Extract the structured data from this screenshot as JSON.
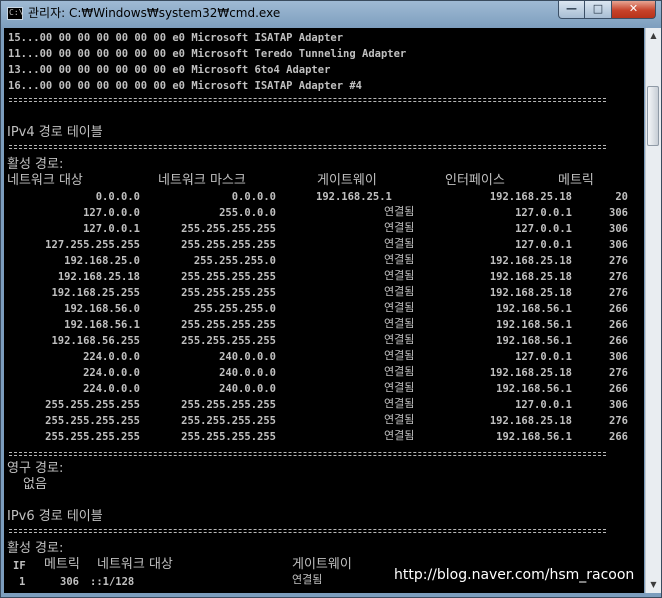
{
  "window": {
    "title": "관리자: C:₩Windows₩system32₩cmd.exe",
    "icon_glyph": "C:\\"
  },
  "buttons": {
    "minimize": "—",
    "maximize": "□",
    "close": "✕"
  },
  "interfaces": [
    "15...00 00 00 00 00 00 00 e0 Microsoft ISATAP Adapter",
    "11...00 00 00 00 00 00 00 e0 Microsoft Teredo Tunneling Adapter",
    "13...00 00 00 00 00 00 00 e0 Microsoft 6to4 Adapter",
    "16...00 00 00 00 00 00 00 e0 Microsoft ISATAP Adapter #4"
  ],
  "ipv4": {
    "heading": "IPv4 경로 테이블",
    "active_label": "활성 경로:",
    "headers": {
      "dest": "네트워크 대상",
      "mask": "네트워크 마스크",
      "gateway": "게이트웨이",
      "iface": "인터페이스",
      "metric": "메트릭"
    },
    "routes": [
      {
        "dest": "0.0.0.0",
        "mask": "0.0.0.0",
        "gateway": "192.168.25.1",
        "iface": "192.168.25.18",
        "metric": "20"
      },
      {
        "dest": "127.0.0.0",
        "mask": "255.0.0.0",
        "gateway": "연결됨",
        "iface": "127.0.0.1",
        "metric": "306"
      },
      {
        "dest": "127.0.0.1",
        "mask": "255.255.255.255",
        "gateway": "연결됨",
        "iface": "127.0.0.1",
        "metric": "306"
      },
      {
        "dest": "127.255.255.255",
        "mask": "255.255.255.255",
        "gateway": "연결됨",
        "iface": "127.0.0.1",
        "metric": "306"
      },
      {
        "dest": "192.168.25.0",
        "mask": "255.255.255.0",
        "gateway": "연결됨",
        "iface": "192.168.25.18",
        "metric": "276"
      },
      {
        "dest": "192.168.25.18",
        "mask": "255.255.255.255",
        "gateway": "연결됨",
        "iface": "192.168.25.18",
        "metric": "276"
      },
      {
        "dest": "192.168.25.255",
        "mask": "255.255.255.255",
        "gateway": "연결됨",
        "iface": "192.168.25.18",
        "metric": "276"
      },
      {
        "dest": "192.168.56.0",
        "mask": "255.255.255.0",
        "gateway": "연결됨",
        "iface": "192.168.56.1",
        "metric": "266"
      },
      {
        "dest": "192.168.56.1",
        "mask": "255.255.255.255",
        "gateway": "연결됨",
        "iface": "192.168.56.1",
        "metric": "266"
      },
      {
        "dest": "192.168.56.255",
        "mask": "255.255.255.255",
        "gateway": "연결됨",
        "iface": "192.168.56.1",
        "metric": "266"
      },
      {
        "dest": "224.0.0.0",
        "mask": "240.0.0.0",
        "gateway": "연결됨",
        "iface": "127.0.0.1",
        "metric": "306"
      },
      {
        "dest": "224.0.0.0",
        "mask": "240.0.0.0",
        "gateway": "연결됨",
        "iface": "192.168.25.18",
        "metric": "276"
      },
      {
        "dest": "224.0.0.0",
        "mask": "240.0.0.0",
        "gateway": "연결됨",
        "iface": "192.168.56.1",
        "metric": "266"
      },
      {
        "dest": "255.255.255.255",
        "mask": "255.255.255.255",
        "gateway": "연결됨",
        "iface": "127.0.0.1",
        "metric": "306"
      },
      {
        "dest": "255.255.255.255",
        "mask": "255.255.255.255",
        "gateway": "연결됨",
        "iface": "192.168.25.18",
        "metric": "276"
      },
      {
        "dest": "255.255.255.255",
        "mask": "255.255.255.255",
        "gateway": "연결됨",
        "iface": "192.168.56.1",
        "metric": "266"
      }
    ],
    "persistent_label": "영구 경로:",
    "persistent_value": "없음"
  },
  "ipv6": {
    "heading": "IPv6 경로 테이블",
    "active_label": "활성 경로:",
    "headers": {
      "if": "IF",
      "metric": "메트릭",
      "dest": "네트워크 대상",
      "gateway": "게이트웨이"
    },
    "routes": [
      {
        "if": "1",
        "metric": "306",
        "dest": "::1/128",
        "gateway": "연결됨"
      }
    ]
  },
  "watermark": "http://blog.naver.com/hsm_racoon",
  "scrollbar": {
    "up": "▲",
    "down": "▼"
  }
}
